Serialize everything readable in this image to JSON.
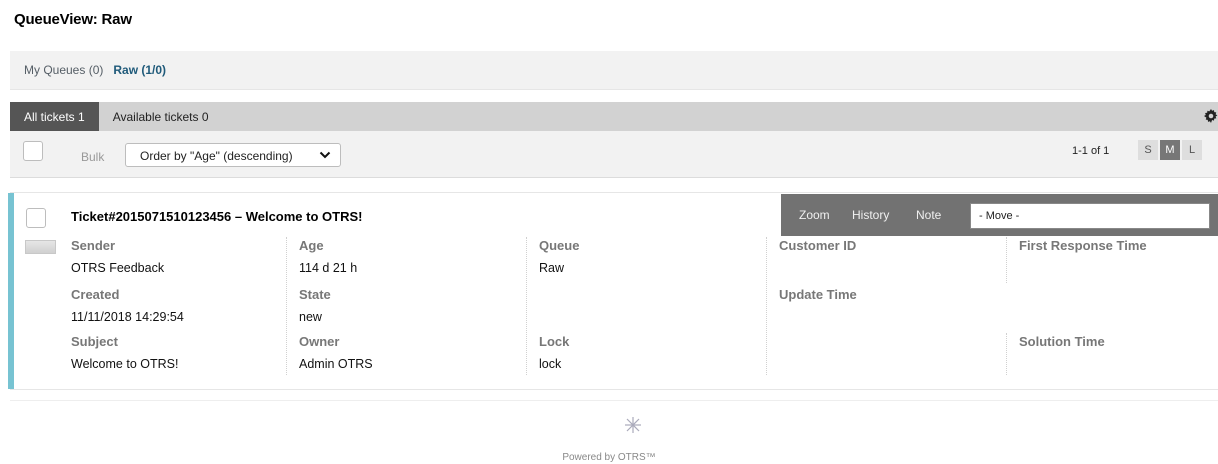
{
  "page": {
    "title": "QueueView: Raw"
  },
  "queues": [
    {
      "label": "My Queues (0)"
    },
    {
      "label": "Raw (1/0)"
    }
  ],
  "tabs": [
    {
      "label": "All tickets 1"
    },
    {
      "label": "Available tickets 0"
    }
  ],
  "toolbar": {
    "bulk_label": "Bulk",
    "order_by": "Order by \"Age\" (descending)",
    "pager": "1-1 of 1",
    "sizes": [
      "S",
      "M",
      "L"
    ],
    "active_size": "M"
  },
  "ticket": {
    "title": "Ticket#2015071510123456 – Welcome to OTRS!",
    "actions": {
      "zoom": "Zoom",
      "history": "History",
      "note": "Note",
      "move": "- Move -"
    },
    "fields": {
      "sender": {
        "label": "Sender",
        "value": "OTRS Feedback"
      },
      "created": {
        "label": "Created",
        "value": "11/11/2018 14:29:54"
      },
      "subject": {
        "label": "Subject",
        "value": "Welcome to OTRS!"
      },
      "age": {
        "label": "Age",
        "value": "114 d 21 h"
      },
      "state": {
        "label": "State",
        "value": "new"
      },
      "owner": {
        "label": "Owner",
        "value": "Admin OTRS"
      },
      "queue": {
        "label": "Queue",
        "value": "Raw"
      },
      "lock": {
        "label": "Lock",
        "value": "lock"
      },
      "customer_id": {
        "label": "Customer ID"
      },
      "update_time": {
        "label": "Update Time"
      },
      "first_response_time": {
        "label": "First Response Time"
      },
      "solution_time": {
        "label": "Solution Time"
      }
    }
  },
  "footer": {
    "powered_by": "Powered by OTRS™"
  },
  "colors": {
    "accent": "#77c3d2",
    "tab_active": "#555555",
    "actions_bg": "#727272"
  }
}
